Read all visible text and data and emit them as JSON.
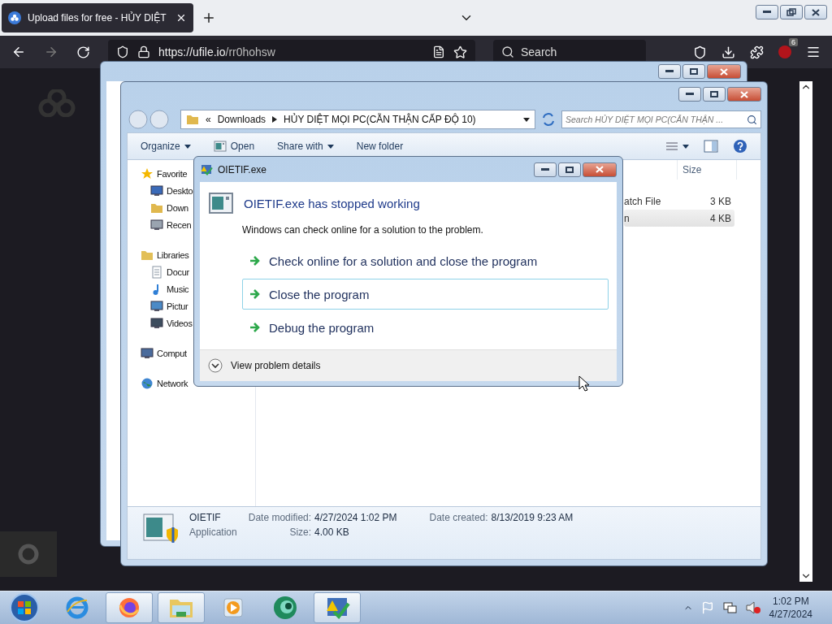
{
  "browser": {
    "tabs": [
      {
        "title": "Upload files for free - HỦY DIỆT",
        "selected": true
      }
    ],
    "url_host": "https://ufile.io",
    "url_path": "/rr0hohsw",
    "search_placeholder": "Search",
    "extension_badge": "6"
  },
  "explorer": {
    "breadcrumb_overflow": "«",
    "breadcrumb": [
      "Downloads",
      "HỦY DIỆT MỌI PC(CẪN THẬN CẤP ĐỘ 10)"
    ],
    "search_placeholder": "Search HỦY DIỆT MỌI PC(CẪN THẬN ...",
    "toolbar": [
      {
        "label": "Organize",
        "kind": "menu"
      },
      {
        "label": "Open",
        "kind": "open"
      },
      {
        "label": "Share with",
        "kind": "menu"
      },
      {
        "label": "New folder",
        "kind": "plain"
      }
    ],
    "nav": [
      {
        "label": "Favorite",
        "kind": "favorites",
        "children": [
          {
            "label": "Deskto",
            "kind": "desktop"
          },
          {
            "label": "Down",
            "kind": "downloads"
          },
          {
            "label": "Recen",
            "kind": "recent"
          }
        ]
      },
      {
        "label": "Libraries",
        "kind": "libraries",
        "children": [
          {
            "label": "Docur",
            "kind": "documents"
          },
          {
            "label": "Music",
            "kind": "music"
          },
          {
            "label": "Pictur",
            "kind": "pictures"
          },
          {
            "label": "Videos",
            "kind": "videos"
          }
        ]
      },
      {
        "label": "Comput",
        "kind": "computer"
      },
      {
        "label": "Network",
        "kind": "network"
      }
    ],
    "columns": [
      "Size"
    ],
    "files": [
      {
        "type": "atch File",
        "size": "3 KB",
        "selected": false
      },
      {
        "type": "n",
        "size": "4 KB",
        "selected": true
      }
    ],
    "details": {
      "name": "OIETIF",
      "type": "Application",
      "fields": [
        {
          "label": "Date modified:",
          "value": "4/27/2024 1:02 PM"
        },
        {
          "label": "Size:",
          "value": "4.00 KB"
        },
        {
          "label": "Date created:",
          "value": "8/13/2019 9:23 AM"
        }
      ]
    }
  },
  "dialog": {
    "title": "OIETIF.exe",
    "heading": "OIETIF.exe has stopped working",
    "message": "Windows can check online for a solution to the problem.",
    "options": [
      {
        "label": "Check online for a solution and close the program",
        "selected": false
      },
      {
        "label": "Close the program",
        "selected": true
      },
      {
        "label": "Debug the program",
        "selected": false
      }
    ],
    "details_toggle": "View problem details"
  },
  "taskbar": {
    "apps": [
      {
        "kind": "ie",
        "active": false
      },
      {
        "kind": "firefox",
        "active": true
      },
      {
        "kind": "explorer",
        "active": true
      },
      {
        "kind": "media",
        "active": false
      },
      {
        "kind": "green",
        "active": false
      },
      {
        "kind": "error",
        "active": true
      }
    ],
    "time": "1:02 PM",
    "date": "4/27/2024"
  }
}
